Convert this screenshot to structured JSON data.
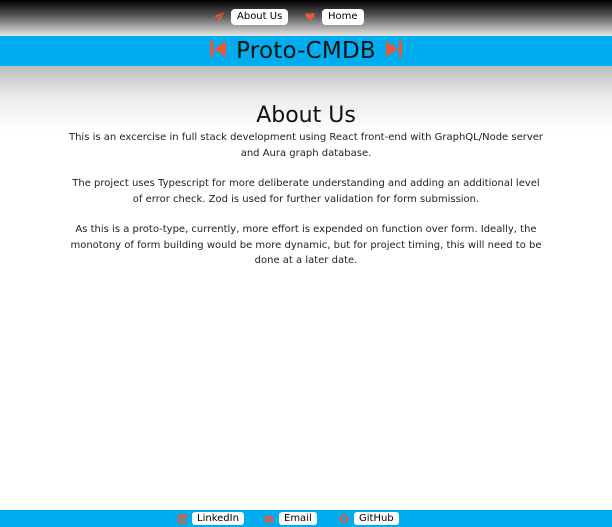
{
  "nav": {
    "about_label": "About Us",
    "home_label": "Home",
    "about_icon": "paper-plane-icon",
    "home_icon": "heart-icon"
  },
  "brand": {
    "title": "Proto-CMDB",
    "left_icon": "skip-back-icon",
    "right_icon": "skip-forward-icon"
  },
  "page": {
    "heading": "About Us",
    "paragraphs": [
      "This is an excercise in full stack development using React front-end with GraphQL/Node server and Aura graph database.",
      "The project uses Typescript for more deliberate understanding and adding an additional level of error check. Zod is used for further validation for form submission.",
      "As this is a proto-type, currently, more effort is expended on function over form. Ideally, the monotony of form building would be more dynamic, but for project timing, this will need to be done at a later date."
    ]
  },
  "footer": {
    "linkedin_label": "LinkedIn",
    "email_label": "Email",
    "github_label": "GitHub",
    "linkedin_icon": "linkedin-icon",
    "email_icon": "email-icon",
    "github_icon": "github-icon"
  },
  "colors": {
    "banner": "#00aeef",
    "accent": "#e85a3c",
    "background": "#ffffff"
  }
}
